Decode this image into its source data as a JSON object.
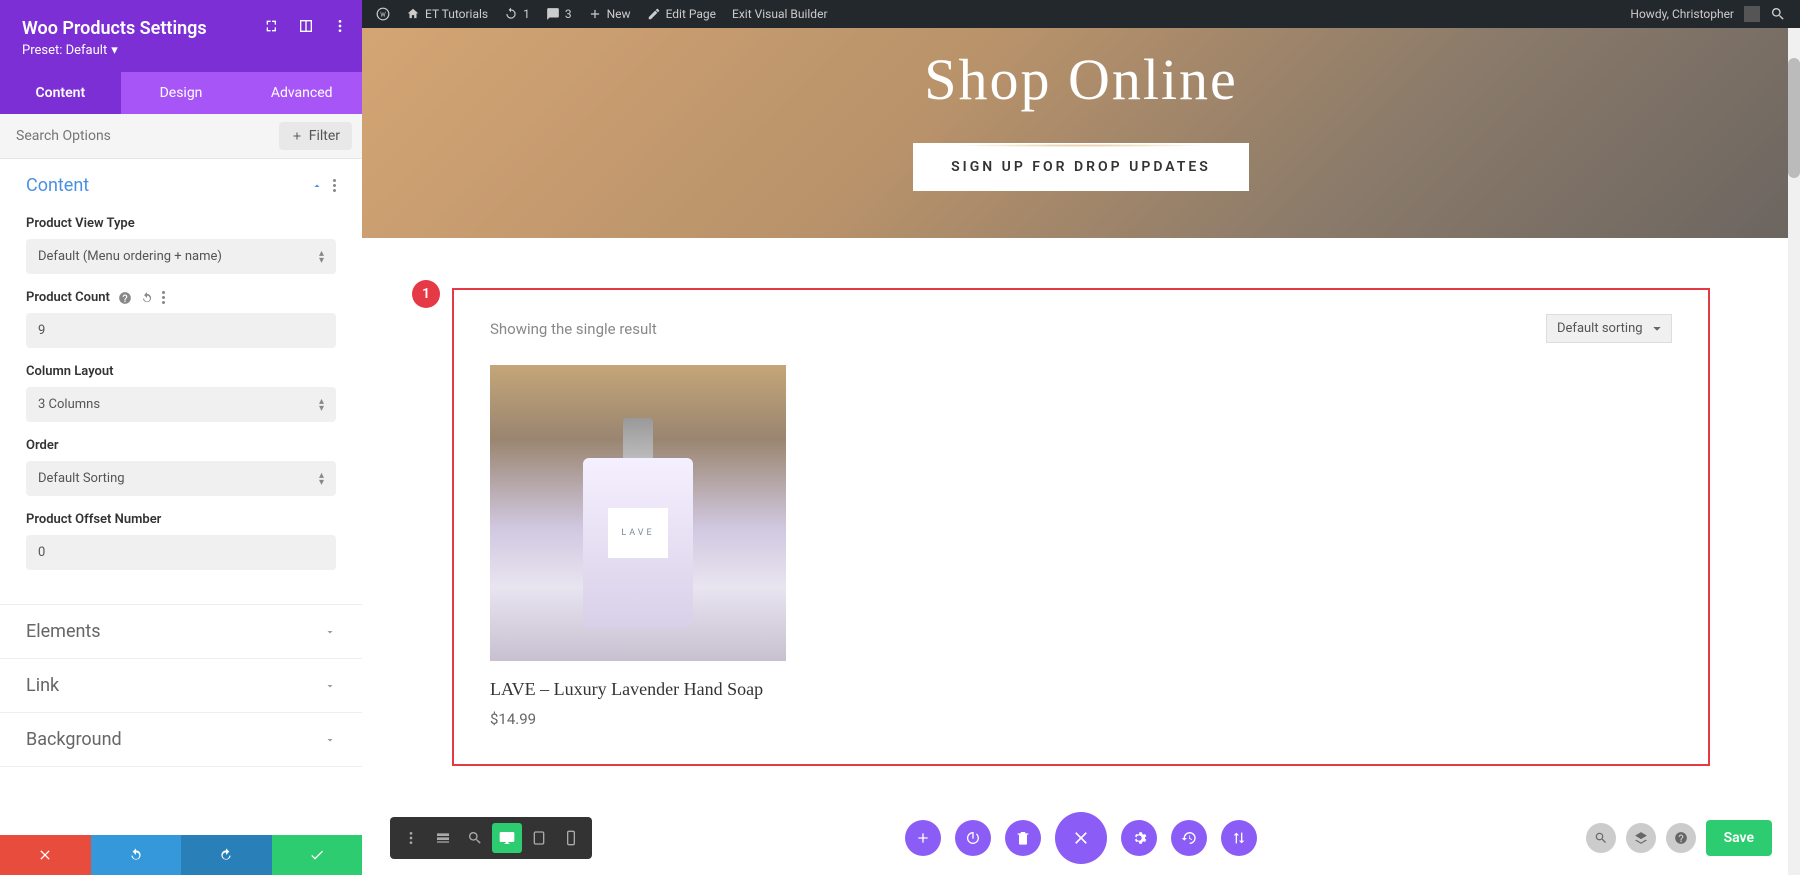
{
  "sidebar": {
    "title": "Woo Products Settings",
    "preset_label": "Preset: Default",
    "tabs": {
      "content": "Content",
      "design": "Design",
      "advanced": "Advanced"
    },
    "search_placeholder": "Search Options",
    "filter_label": "Filter",
    "sections": {
      "content": {
        "title": "Content",
        "fields": {
          "product_view_type": {
            "label": "Product View Type",
            "value": "Default (Menu ordering + name)"
          },
          "product_count": {
            "label": "Product Count",
            "value": "9"
          },
          "column_layout": {
            "label": "Column Layout",
            "value": "3 Columns"
          },
          "order": {
            "label": "Order",
            "value": "Default Sorting"
          },
          "product_offset": {
            "label": "Product Offset Number",
            "value": "0"
          }
        }
      },
      "elements": {
        "title": "Elements"
      },
      "link": {
        "title": "Link"
      },
      "background": {
        "title": "Background"
      }
    }
  },
  "admin_bar": {
    "site": "ET Tutorials",
    "updates": "1",
    "comments": "3",
    "new": "New",
    "edit_page": "Edit Page",
    "exit_vb": "Exit Visual Builder",
    "howdy": "Howdy, Christopher"
  },
  "hero": {
    "title": "Shop Online",
    "cta": "SIGN UP FOR DROP UPDATES"
  },
  "module": {
    "badge": "1",
    "result_text": "Showing the single result",
    "sort_value": "Default sorting",
    "product": {
      "brand": "LAVE",
      "title": "LAVE – Luxury Lavender Hand Soap",
      "price": "$14.99"
    }
  },
  "bottom": {
    "save": "Save"
  },
  "colors": {
    "purple": "#7c2fd4",
    "red": "#e63946",
    "green": "#2ecc71"
  }
}
